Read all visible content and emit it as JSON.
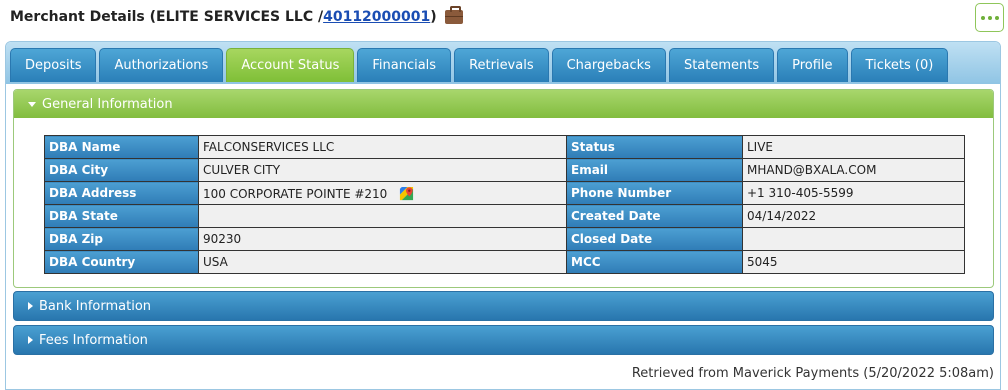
{
  "header": {
    "title_prefix": "Merchant Details (ELITE SERVICES LLC / ",
    "mid": "40112000001",
    "title_suffix": ")"
  },
  "tabs": [
    {
      "label": "Deposits",
      "active": false
    },
    {
      "label": "Authorizations",
      "active": false
    },
    {
      "label": "Account Status",
      "active": true
    },
    {
      "label": "Financials",
      "active": false
    },
    {
      "label": "Retrievals",
      "active": false
    },
    {
      "label": "Chargebacks",
      "active": false
    },
    {
      "label": "Statements",
      "active": false
    },
    {
      "label": "Profile",
      "active": false
    },
    {
      "label": "Tickets (0)",
      "active": false
    }
  ],
  "general": {
    "title": "General Information",
    "rows": [
      {
        "l1": "DBA Name",
        "v1": "FALCONSERVICES LLC",
        "l2": "Status",
        "v2": "LIVE"
      },
      {
        "l1": "DBA City",
        "v1": "CULVER CITY",
        "l2": "Email",
        "v2": "MHAND@BXALA.COM"
      },
      {
        "l1": "DBA Address",
        "v1": "100 CORPORATE POINTE #210",
        "l2": "Phone Number",
        "v2": "+1 310-405-5599"
      },
      {
        "l1": "DBA State",
        "v1": "",
        "l2": "Created Date",
        "v2": "04/14/2022"
      },
      {
        "l1": "DBA Zip",
        "v1": "90230",
        "l2": "Closed Date",
        "v2": ""
      },
      {
        "l1": "DBA Country",
        "v1": "USA",
        "l2": "MCC",
        "v2": "5045"
      }
    ]
  },
  "bank": {
    "title": "Bank Information"
  },
  "fees": {
    "title": "Fees Information"
  },
  "footer": {
    "note": "Retrieved from Maverick Payments (5/20/2022 5:08am)"
  },
  "icons": {
    "briefcase": "briefcase-icon",
    "more": "more-options-icon",
    "map": "google-maps-icon"
  },
  "colors": {
    "active_tab": "#8cc63f",
    "tab": "#3a94cc",
    "link": "#1a4db3"
  }
}
